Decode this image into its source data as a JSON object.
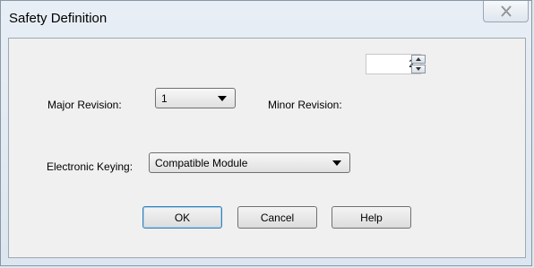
{
  "dialog": {
    "title": "Safety Definition",
    "close_icon": "close-x-icon"
  },
  "fields": {
    "major_revision": {
      "label": "Major Revision:",
      "value": "1"
    },
    "minor_revision": {
      "label": "Minor Revision:",
      "value": "2"
    },
    "electronic_keying": {
      "label": "Electronic Keying:",
      "value": "Compatible Module"
    }
  },
  "buttons": {
    "ok": "OK",
    "cancel": "Cancel",
    "help": "Help"
  },
  "colors": {
    "title_bar": "#e8eef5",
    "client_area": "#f0f0f0",
    "default_button_border": "#3c7fb1"
  }
}
